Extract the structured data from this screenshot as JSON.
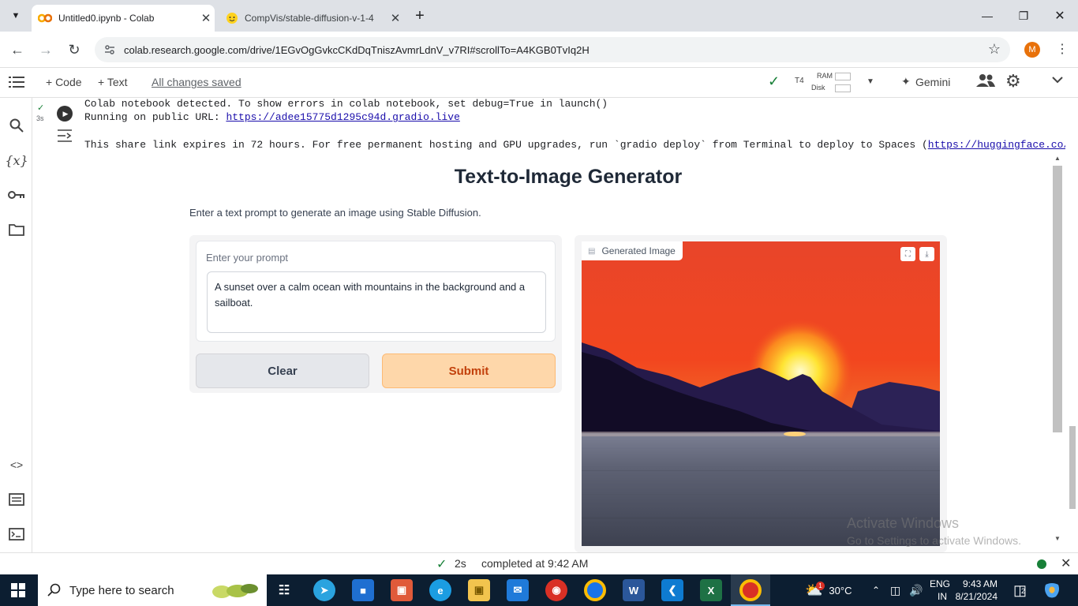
{
  "browser": {
    "tabs": [
      {
        "title": "Untitled0.ipynb - Colab",
        "icon": "colab-icon"
      },
      {
        "title": "CompVis/stable-diffusion-v-1-4",
        "icon": "huggingface-icon"
      }
    ],
    "url": "colab.research.google.com/drive/1EGvOgGvkcCKdDqTniszAvmrLdnV_v7RI#scrollTo=A4KGB0TvIq2H",
    "profile_initial": "M"
  },
  "colab_toolbar": {
    "code_label": "+ Code",
    "text_label": "+ Text",
    "save_status": "All changes saved",
    "runtime_type": "T4",
    "ram_label": "RAM",
    "disk_label": "Disk",
    "gemini_label": "Gemini"
  },
  "cell": {
    "exec_time": "3s",
    "output_lines": [
      "Colab notebook detected. To show errors in colab notebook, set debug=True in launch()",
      "Running on public URL: ",
      "This share link expires in 72 hours. For free permanent hosting and GPU upgrades, run `gradio deploy` from Terminal to deploy to Spaces ("
    ],
    "public_url": "https://adee15775d1295c94d.gradio.live",
    "spaces_url": "https://huggingface.co/sp"
  },
  "gradio": {
    "title": "Text-to-Image Generator",
    "description": "Enter a text prompt to generate an image using Stable Diffusion.",
    "prompt_label": "Enter your prompt",
    "prompt_value": "A sunset over a calm ocean with mountains in the background and a sailboat.",
    "clear_label": "Clear",
    "submit_label": "Submit",
    "image_label": "Generated Image"
  },
  "watermark": {
    "line1": "Activate Windows",
    "line2": "Go to Settings to activate Windows."
  },
  "status_bar": {
    "duration": "2s",
    "message": "completed at 9:42 AM"
  },
  "taskbar": {
    "search_placeholder": "Type here to search",
    "temperature": "30°C",
    "language": "ENG",
    "region": "IN",
    "time": "9:43 AM",
    "date": "8/21/2024",
    "notification_count": "2",
    "weather_badge": "1"
  },
  "colors": {
    "tab_strip": "#dee1e6",
    "submit_bg": "#fed7aa",
    "submit_text": "#c2410c",
    "taskbar": "#0c1e31"
  }
}
